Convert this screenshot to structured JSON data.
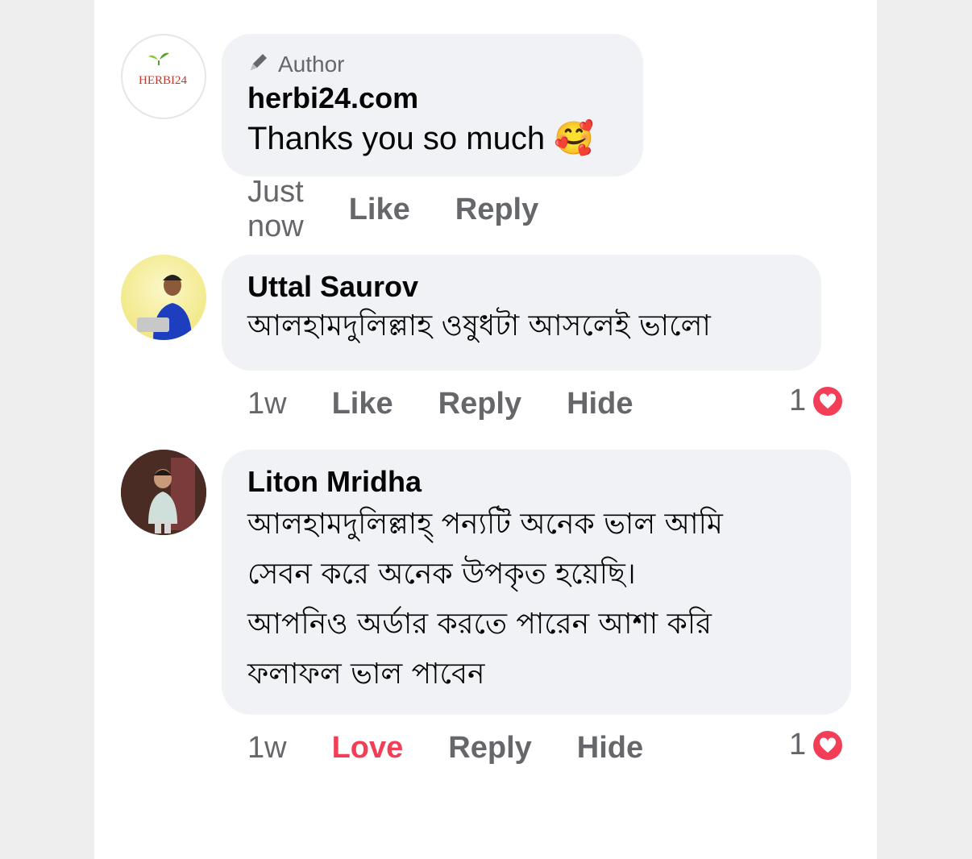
{
  "comments": [
    {
      "author_tag": "Author",
      "name": "herbi24.com",
      "text": "Thanks you so much",
      "emoji": "🥰",
      "avatar_logo": "HERBI24",
      "actions": {
        "time": "Just now",
        "like": "Like",
        "reply": "Reply"
      }
    },
    {
      "name": "Uttal Saurov",
      "text": "আলহামদুলিল্লাহ ওষুধটা আসলেই ভালো",
      "actions": {
        "time": "1w",
        "like": "Like",
        "reply": "Reply",
        "hide": "Hide"
      },
      "reaction_count": "1"
    },
    {
      "name": "Liton Mridha",
      "text_lines": [
        "আলহামদুলিল্লাহ্ পন্যটি অনেক ভাল  আমি",
        "সেবন করে অনেক উপকৃত হয়েছি।",
        "আপনিও অর্ডার করতে পারেন আশা করি",
        "ফলাফল ভাল পাবেন"
      ],
      "actions": {
        "time": "1w",
        "love": "Love",
        "reply": "Reply",
        "hide": "Hide"
      },
      "reaction_count": "1"
    }
  ],
  "colors": {
    "love": "#f33e58",
    "bubble": "#f0f2f5",
    "meta": "#65676b"
  },
  "icons": {
    "author": "pencil-icon",
    "reaction": "heart-icon"
  }
}
